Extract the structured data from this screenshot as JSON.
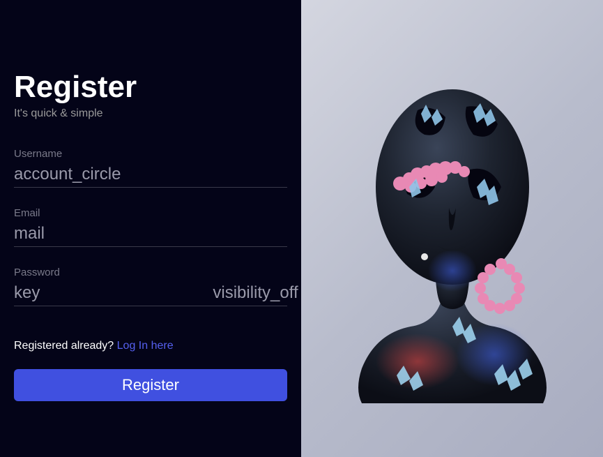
{
  "page": {
    "title": "Register",
    "subtitle": "It's quick & simple"
  },
  "fields": {
    "username": {
      "label": "Username",
      "icon": "account_circle",
      "value": ""
    },
    "email": {
      "label": "Email",
      "icon": "mail",
      "value": ""
    },
    "password": {
      "label": "Password",
      "icon_left": "key",
      "icon_right": "visibility_off",
      "value": ""
    }
  },
  "login_prompt": {
    "text": "Registered already? ",
    "link_text": "Log In here"
  },
  "submit": {
    "label": "Register"
  },
  "colors": {
    "panel_bg": "#040418",
    "accent": "#4050e0",
    "link": "#5560f0",
    "muted": "#7a7a8a"
  }
}
